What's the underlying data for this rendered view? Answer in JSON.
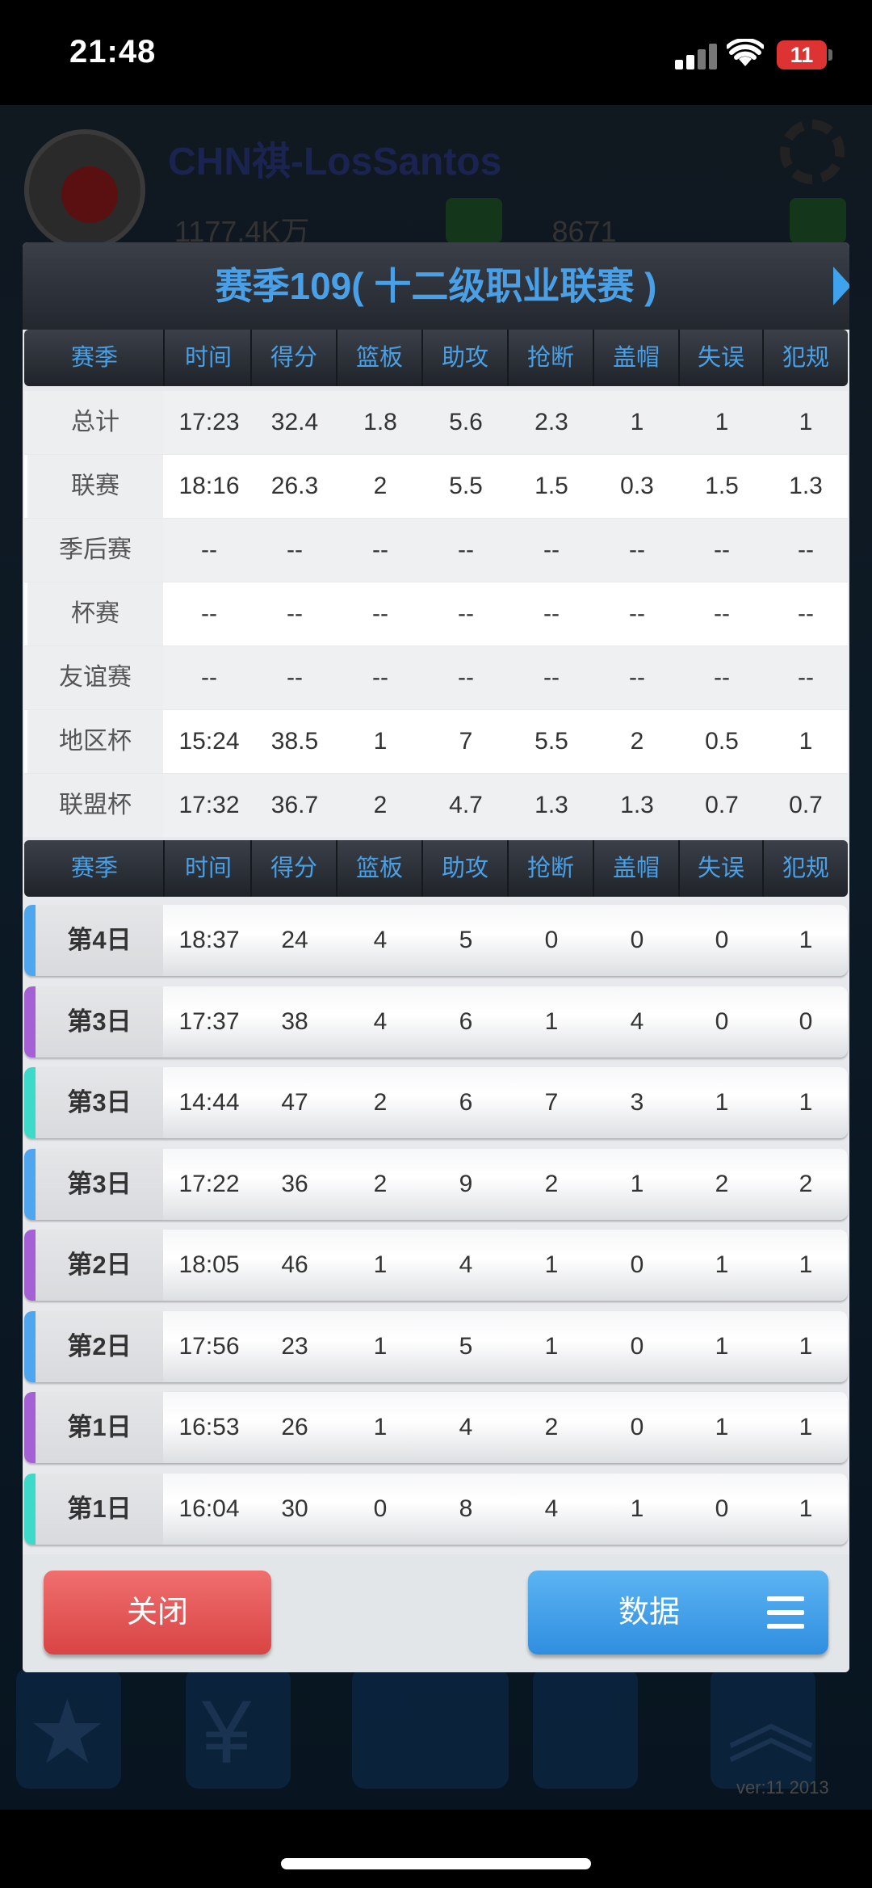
{
  "status_bar": {
    "time": "21:48",
    "battery": "11"
  },
  "background": {
    "team_name": "CHN祺-LosSantos",
    "funds": "1177.4K万",
    "gems": "8671",
    "version": "ver:11  2013"
  },
  "dialog": {
    "title": "赛季109( 十二级职业联赛 )",
    "columns": [
      "赛季",
      "时间",
      "得分",
      "篮板",
      "助攻",
      "抢断",
      "盖帽",
      "失误",
      "犯规"
    ],
    "season_rows": [
      {
        "label": "总计",
        "color": "#3dd9c9",
        "values": [
          "17:23",
          "32.4",
          "1.8",
          "5.6",
          "2.3",
          "1",
          "1",
          "1"
        ]
      },
      {
        "label": "联赛",
        "color": "#4ea6ee",
        "values": [
          "18:16",
          "26.3",
          "2",
          "5.5",
          "1.5",
          "0.3",
          "1.5",
          "1.3"
        ]
      },
      {
        "label": "季后赛",
        "color": "#f25a5a",
        "values": [
          "--",
          "--",
          "--",
          "--",
          "--",
          "--",
          "--",
          "--"
        ]
      },
      {
        "label": "杯赛",
        "color": "#6cc234",
        "values": [
          "--",
          "--",
          "--",
          "--",
          "--",
          "--",
          "--",
          "--"
        ]
      },
      {
        "label": "友谊赛",
        "color": "#f5a040",
        "values": [
          "--",
          "--",
          "--",
          "--",
          "--",
          "--",
          "--",
          "--"
        ]
      },
      {
        "label": "地区杯",
        "color": "#3dd9c9",
        "values": [
          "15:24",
          "38.5",
          "1",
          "7",
          "5.5",
          "2",
          "0.5",
          "1"
        ]
      },
      {
        "label": "联盟杯",
        "color": "#a560d6",
        "values": [
          "17:32",
          "36.7",
          "2",
          "4.7",
          "1.3",
          "1.3",
          "0.7",
          "0.7"
        ]
      }
    ],
    "game_rows": [
      {
        "label": "第4日",
        "color": "#4ea6ee",
        "values": [
          "18:37",
          "24",
          "4",
          "5",
          "0",
          "0",
          "0",
          "1"
        ]
      },
      {
        "label": "第3日",
        "color": "#a560d6",
        "values": [
          "17:37",
          "38",
          "4",
          "6",
          "1",
          "4",
          "0",
          "0"
        ]
      },
      {
        "label": "第3日",
        "color": "#3dd9c9",
        "values": [
          "14:44",
          "47",
          "2",
          "6",
          "7",
          "3",
          "1",
          "1"
        ]
      },
      {
        "label": "第3日",
        "color": "#4ea6ee",
        "values": [
          "17:22",
          "36",
          "2",
          "9",
          "2",
          "1",
          "2",
          "2"
        ]
      },
      {
        "label": "第2日",
        "color": "#a560d6",
        "values": [
          "18:05",
          "46",
          "1",
          "4",
          "1",
          "0",
          "1",
          "1"
        ]
      },
      {
        "label": "第2日",
        "color": "#4ea6ee",
        "values": [
          "17:56",
          "23",
          "1",
          "5",
          "1",
          "0",
          "1",
          "1"
        ]
      },
      {
        "label": "第1日",
        "color": "#a560d6",
        "values": [
          "16:53",
          "26",
          "1",
          "4",
          "2",
          "0",
          "1",
          "1"
        ]
      },
      {
        "label": "第1日",
        "color": "#3dd9c9",
        "values": [
          "16:04",
          "30",
          "0",
          "8",
          "4",
          "1",
          "0",
          "1"
        ]
      }
    ],
    "close_label": "关闭",
    "data_label": "数据"
  }
}
